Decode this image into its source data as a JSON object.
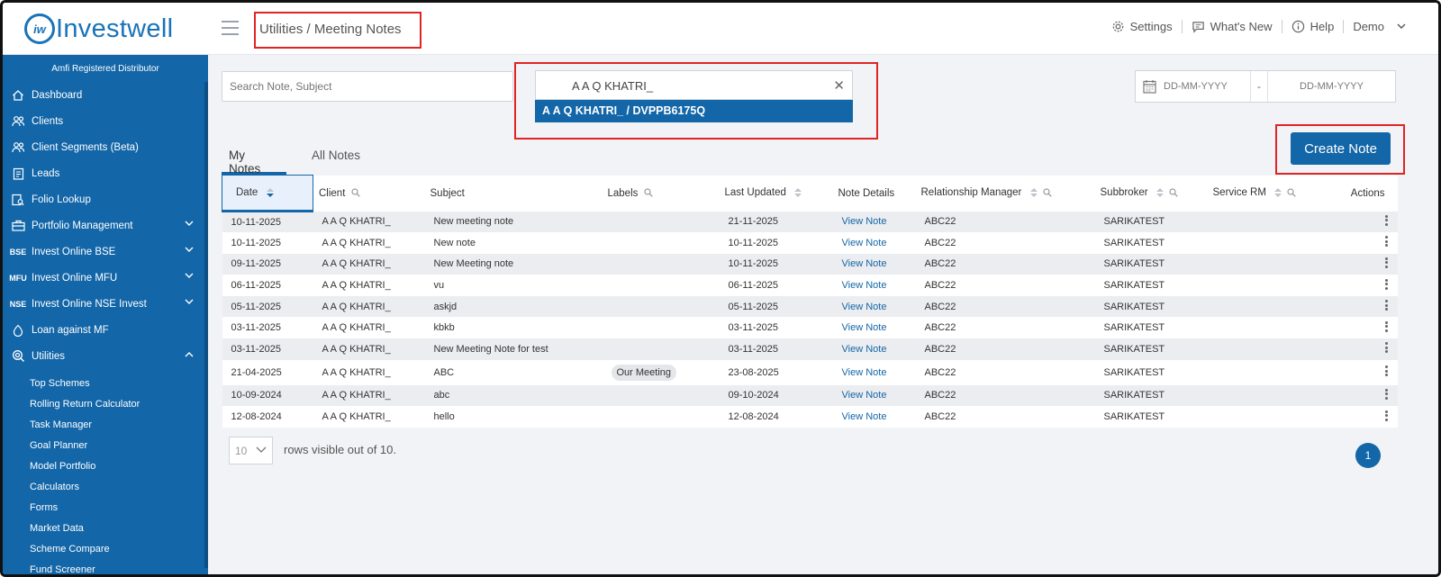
{
  "header": {
    "logo_mark": "iw",
    "logo_text": "Investwell",
    "breadcrumb": "Utilities / Meeting Notes",
    "settings": "Settings",
    "whats_new": "What's New",
    "help": "Help",
    "user": "Demo"
  },
  "sidebar": {
    "amfi": "Amfi Registered Distributor",
    "items": [
      {
        "label": "Dashboard",
        "icon": "home-icon"
      },
      {
        "label": "Clients",
        "icon": "users-icon"
      },
      {
        "label": "Client Segments (Beta)",
        "icon": "users-icon"
      },
      {
        "label": "Leads",
        "icon": "clipboard-icon"
      },
      {
        "label": "Folio Lookup",
        "icon": "folio-icon"
      },
      {
        "label": "Portfolio Management",
        "icon": "briefcase-icon"
      },
      {
        "label": "Invest Online BSE",
        "icon_text": "BSE"
      },
      {
        "label": "Invest Online MFU",
        "icon_text": "MFU"
      },
      {
        "label": "Invest Online NSE Invest",
        "icon_text": "NSE"
      },
      {
        "label": "Loan against MF",
        "icon": "loan-icon"
      },
      {
        "label": "Utilities",
        "icon": "utilities-icon"
      }
    ],
    "sub_items": [
      "Top Schemes",
      "Rolling Return Calculator",
      "Task Manager",
      "Goal Planner",
      "Model Portfolio",
      "Calculators",
      "Forms",
      "Market Data",
      "Scheme Compare",
      "Fund Screener"
    ]
  },
  "filters": {
    "search_placeholder": "Search Note, Subject",
    "client_value": "A A Q KHATRI_",
    "client_option": "A A Q KHATRI_ / DVPPB6175Q",
    "date_from": "DD-MM-YYYY",
    "date_sep": "-",
    "date_to": "DD-MM-YYYY"
  },
  "create_note": "Create Note",
  "tabs": [
    "My Notes",
    "All Notes"
  ],
  "table": {
    "columns": [
      "Date",
      "Client",
      "Subject",
      "Labels",
      "Last Updated",
      "Note Details",
      "Relationship Manager",
      "Subbroker",
      "Service RM",
      "Actions"
    ],
    "rows": [
      {
        "date": "10-11-2025",
        "client": "A A Q KHATRI_",
        "subject": "New meeting note",
        "label": "",
        "updated": "21-11-2025",
        "details": "View Note",
        "rm": "ABC22",
        "subbroker": "SARIKATEST",
        "service_rm": ""
      },
      {
        "date": "10-11-2025",
        "client": "A A Q KHATRI_",
        "subject": "New note",
        "label": "",
        "updated": "10-11-2025",
        "details": "View Note",
        "rm": "ABC22",
        "subbroker": "SARIKATEST",
        "service_rm": ""
      },
      {
        "date": "09-11-2025",
        "client": "A A Q KHATRI_",
        "subject": "New Meeting note",
        "label": "",
        "updated": "10-11-2025",
        "details": "View Note",
        "rm": "ABC22",
        "subbroker": "SARIKATEST",
        "service_rm": ""
      },
      {
        "date": "06-11-2025",
        "client": "A A Q KHATRI_",
        "subject": "vu",
        "label": "",
        "updated": "06-11-2025",
        "details": "View Note",
        "rm": "ABC22",
        "subbroker": "SARIKATEST",
        "service_rm": ""
      },
      {
        "date": "05-11-2025",
        "client": "A A Q KHATRI_",
        "subject": "askjd",
        "label": "",
        "updated": "05-11-2025",
        "details": "View Note",
        "rm": "ABC22",
        "subbroker": "SARIKATEST",
        "service_rm": ""
      },
      {
        "date": "03-11-2025",
        "client": "A A Q KHATRI_",
        "subject": "kbkb",
        "label": "",
        "updated": "03-11-2025",
        "details": "View Note",
        "rm": "ABC22",
        "subbroker": "SARIKATEST",
        "service_rm": ""
      },
      {
        "date": "03-11-2025",
        "client": "A A Q KHATRI_",
        "subject": "New Meeting Note for test",
        "label": "",
        "updated": "03-11-2025",
        "details": "View Note",
        "rm": "ABC22",
        "subbroker": "SARIKATEST",
        "service_rm": ""
      },
      {
        "date": "21-04-2025",
        "client": "A A Q KHATRI_",
        "subject": "ABC",
        "label": "Our Meeting",
        "updated": "23-08-2025",
        "details": "View Note",
        "rm": "ABC22",
        "subbroker": "SARIKATEST",
        "service_rm": ""
      },
      {
        "date": "10-09-2024",
        "client": "A A Q KHATRI_",
        "subject": "abc",
        "label": "",
        "updated": "09-10-2024",
        "details": "View Note",
        "rm": "ABC22",
        "subbroker": "SARIKATEST",
        "service_rm": ""
      },
      {
        "date": "12-08-2024",
        "client": "A A Q KHATRI_",
        "subject": "hello",
        "label": "",
        "updated": "12-08-2024",
        "details": "View Note",
        "rm": "ABC22",
        "subbroker": "SARIKATEST",
        "service_rm": ""
      }
    ]
  },
  "pagination": {
    "rows_per_page": "10",
    "rows_text": "rows visible out of 10.",
    "current_page": "1"
  },
  "colors": {
    "brand": "#1366a8",
    "highlight": "#e02424"
  }
}
